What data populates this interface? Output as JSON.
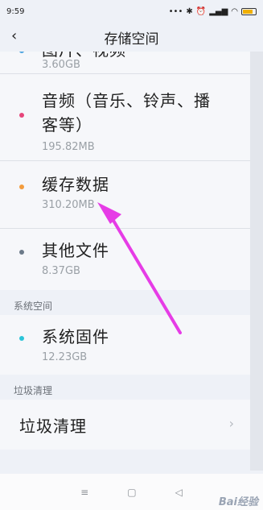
{
  "status_bar": {
    "time": "9:59",
    "icons": [
      "dots-icon",
      "bluetooth-icon",
      "alarm-icon",
      "signal-icon",
      "wifi-icon",
      "battery-icon"
    ],
    "battery_level": 0.8
  },
  "header": {
    "title": "存储空间",
    "back_icon": "chevron-left-icon"
  },
  "storage_items": [
    {
      "name": "图片、视频",
      "size": "3.60GB",
      "color": "#4aa3df"
    },
    {
      "name": "音频（音乐、铃声、播客等）",
      "size": "195.82MB",
      "color": "#e6457a"
    },
    {
      "name": "缓存数据",
      "size": "310.20MB",
      "color": "#f39c3d"
    },
    {
      "name": "其他文件",
      "size": "8.37GB",
      "color": "#6c7a89"
    }
  ],
  "system_section": {
    "label": "系统空间",
    "items": [
      {
        "name": "系统固件",
        "size": "12.23GB",
        "color": "#2bc4d8"
      }
    ]
  },
  "cleanup_section": {
    "label": "垃圾清理",
    "row_label": "垃圾清理"
  },
  "nav_bar": {
    "menu_glyph": "≡",
    "home_glyph": "▢",
    "back_glyph": "◁"
  },
  "watermark": "Bai经验",
  "annotation_color": "#e63ce6"
}
